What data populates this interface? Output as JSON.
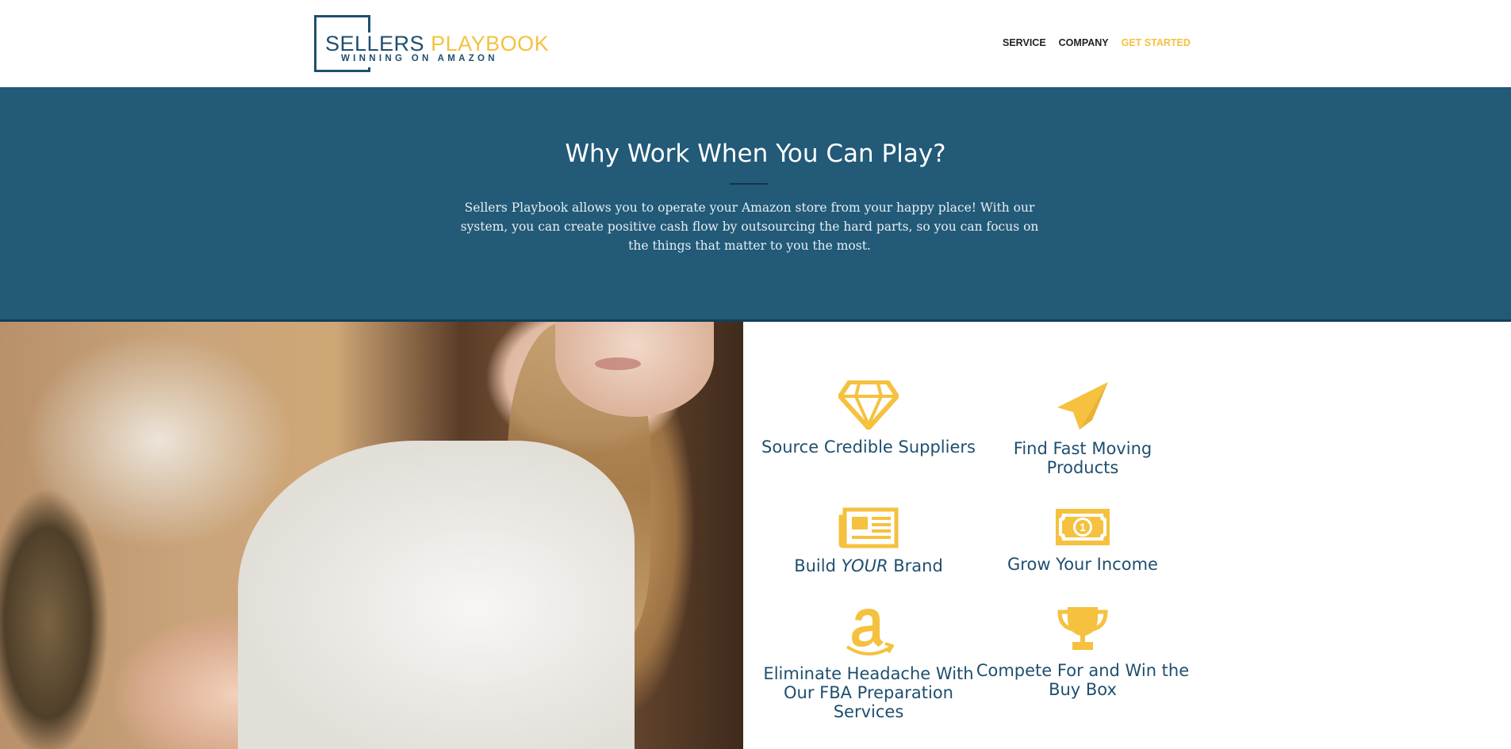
{
  "header": {
    "logo": {
      "word1": "SELLERS",
      "word2": "PLAYBOOK",
      "tagline": "WINNING ON AMAZON"
    },
    "nav": [
      {
        "label": "SERVICE"
      },
      {
        "label": "COMPANY"
      },
      {
        "label": "GET STARTED"
      }
    ]
  },
  "hero": {
    "title": "Why Work When You Can Play?",
    "body": "Sellers Playbook allows you to operate your Amazon store from your happy place! With our system, you can create positive cash flow by outsourcing the hard parts, so you can focus on the things that matter to you the most."
  },
  "features": [
    {
      "icon": "diamond-icon",
      "label": "Source Credible Suppliers"
    },
    {
      "icon": "paper-plane-icon",
      "label": "Find Fast Moving Products"
    },
    {
      "icon": "newspaper-icon",
      "label_prefix": "Build ",
      "label_em": "YOUR",
      "label_suffix": " Brand"
    },
    {
      "icon": "money-icon",
      "label": "Grow Your Income"
    },
    {
      "icon": "amazon-icon",
      "label": "Eliminate Headache With Our FBA Preparation Services"
    },
    {
      "icon": "trophy-icon",
      "label": "Compete For and Win the Buy Box"
    }
  ],
  "colors": {
    "brand_blue": "#1f4f6e",
    "hero_bg": "#225a78",
    "accent_yellow": "#f5c13e"
  }
}
